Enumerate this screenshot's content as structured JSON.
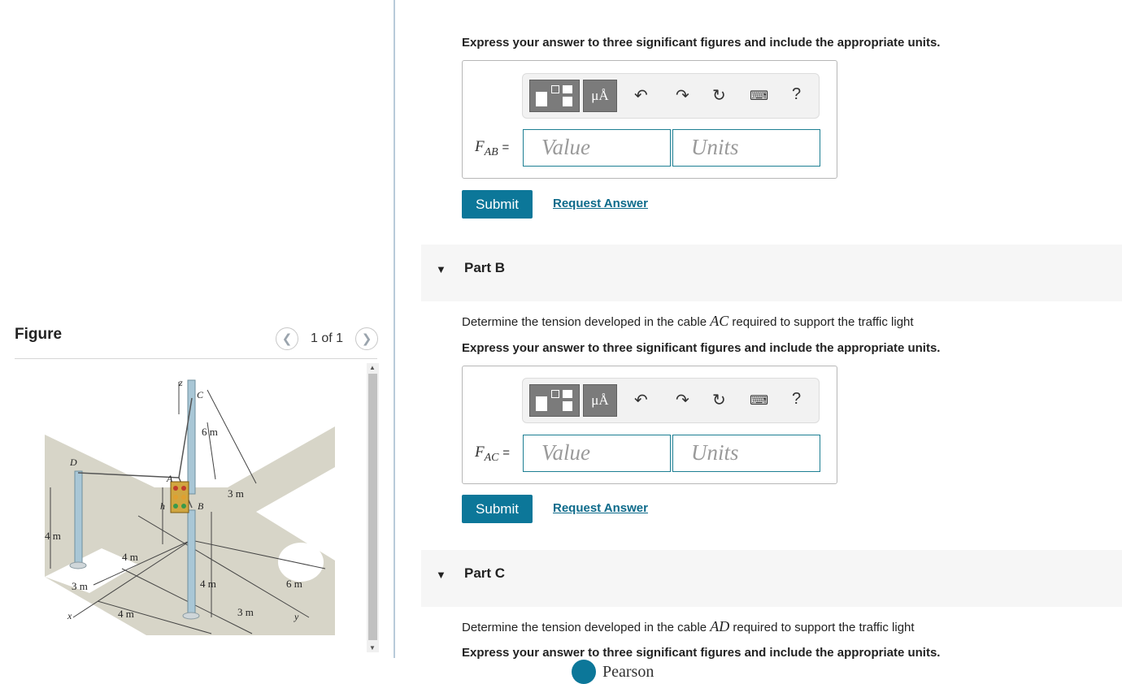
{
  "figure_panel": {
    "title": "Figure",
    "pager": "1 of 1",
    "labels": {
      "z": "z",
      "C": "C",
      "D": "D",
      "A": "A",
      "B": "B",
      "h": "h",
      "x": "x",
      "y": "y",
      "d_6m_top": "6 m",
      "d_3m_mid": "3 m",
      "d_4m_left": "4 m",
      "d_4m_diag": "4 m",
      "d_3m_left": "3 m",
      "d_4m_bottom": "4 m",
      "d_4m_pole": "4 m",
      "d_6m_right": "6 m",
      "d_3m_bottom": "3 m"
    }
  },
  "part_a": {
    "instruction": "Express your answer to three significant figures and include the appropriate units.",
    "field_var": "F",
    "field_sub": "AB",
    "field_eq": "=",
    "value_placeholder": "Value",
    "units_placeholder": "Units",
    "submit_label": "Submit",
    "request_label": "Request Answer"
  },
  "part_b": {
    "title": "Part B",
    "prompt_before": "Determine the tension developed in the cable ",
    "prompt_var": "AC",
    "prompt_after": " required to support the traffic light",
    "instruction": "Express your answer to three significant figures and include the appropriate units.",
    "field_var": "F",
    "field_sub": "AC",
    "field_eq": "=",
    "value_placeholder": "Value",
    "units_placeholder": "Units",
    "submit_label": "Submit",
    "request_label": "Request Answer"
  },
  "part_c": {
    "title": "Part C",
    "prompt_before": "Determine the tension developed in the cable ",
    "prompt_var": "AD",
    "prompt_after": " required to support the traffic light",
    "instruction": "Express your answer to three significant figures and include the appropriate units."
  },
  "toolbar": {
    "units_button": "μÅ",
    "help": "?",
    "icons": [
      "templates-icon",
      "units-icon",
      "undo-icon",
      "redo-icon",
      "reset-icon",
      "keyboard-icon",
      "help-icon"
    ]
  },
  "footer": {
    "logo_text": "Pearson"
  },
  "colors": {
    "accent": "#0c7799",
    "input_border": "#1d7f93",
    "band": "#f6f6f6"
  }
}
